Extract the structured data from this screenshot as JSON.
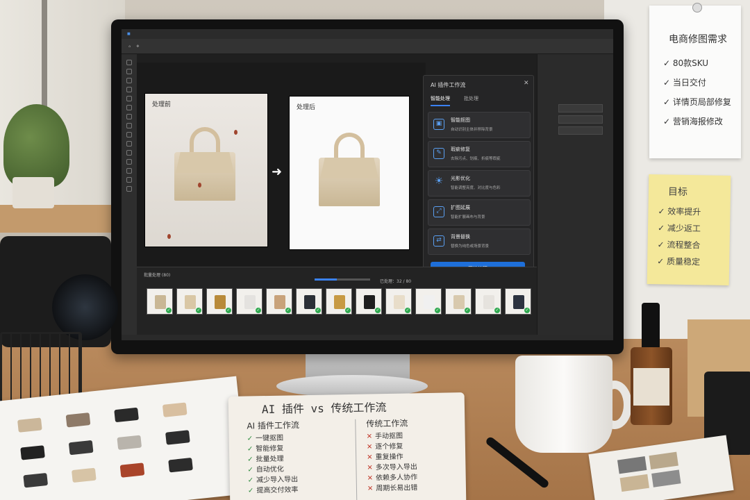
{
  "app": {
    "menu_items": [
      "",
      "",
      "",
      "",
      "",
      "",
      "",
      "",
      "",
      "",
      "",
      "",
      ""
    ],
    "tab_title": ""
  },
  "canvas": {
    "before_label": "处理前",
    "after_label": "处理后",
    "arrow_icon": "arrow-right-icon"
  },
  "ai_panel": {
    "title": "AI 插件工作流",
    "tabs": [
      {
        "label": "智能处理",
        "active": true
      },
      {
        "label": "批处理",
        "active": false
      }
    ],
    "features": [
      {
        "title": "智能抠图",
        "desc": "自动识别主体并移除背景",
        "icon": "image-cutout-icon"
      },
      {
        "title": "瑕疵修复",
        "desc": "去除污点、划痕、折痕等瑕疵",
        "icon": "repair-icon"
      },
      {
        "title": "光影优化",
        "desc": "智能调整亮度、对比度与色彩",
        "icon": "sun-icon"
      },
      {
        "title": "扩图延展",
        "desc": "智能扩展画布与背景",
        "icon": "expand-icon"
      },
      {
        "title": "背景替换",
        "desc": "替换为纯色或场景背景",
        "icon": "background-swap-icon"
      }
    ],
    "start_button": "开始处理"
  },
  "batch": {
    "label": "批量处理 (80)",
    "progress_text": "已处理：32 / 80",
    "progress_fraction": 0.4,
    "thumbnails": [
      {
        "color": "#c9b795"
      },
      {
        "color": "#d9c7a5"
      },
      {
        "color": "#b88a3a"
      },
      {
        "color": "#e4e2df"
      },
      {
        "color": "#c8a27a"
      },
      {
        "color": "#2b2f36"
      },
      {
        "color": "#c79a44"
      },
      {
        "color": "#1e1e1e"
      },
      {
        "color": "#e8ddc9"
      },
      {
        "color": "#f0f0f0"
      },
      {
        "color": "#d8c9ad"
      },
      {
        "color": "#e6e3de"
      },
      {
        "color": "#2d3340"
      }
    ]
  },
  "requirements_note": {
    "title": "电商修图需求",
    "items": [
      "✓ 80款SKU",
      "✓ 当日交付",
      "✓ 详情页局部修复",
      "✓ 营销海报修改"
    ]
  },
  "goal_note": {
    "title": "目标",
    "items": [
      "✓ 效率提升",
      "✓ 减少返工",
      "✓ 流程整合",
      "✓ 质量稳定"
    ]
  },
  "notebook": {
    "title": "AI 插件 vs 传统工作流",
    "ai_col": {
      "head": "AI 插件工作流",
      "items": [
        "一键抠图",
        "智能修复",
        "批量处理",
        "自动优化",
        "减少导入导出",
        "提高交付效率"
      ]
    },
    "trad_col": {
      "head": "传统工作流",
      "items": [
        "手动抠图",
        "逐个修复",
        "重复操作",
        "多次导入导出",
        "依赖多人协作",
        "周期长易出错"
      ]
    }
  }
}
